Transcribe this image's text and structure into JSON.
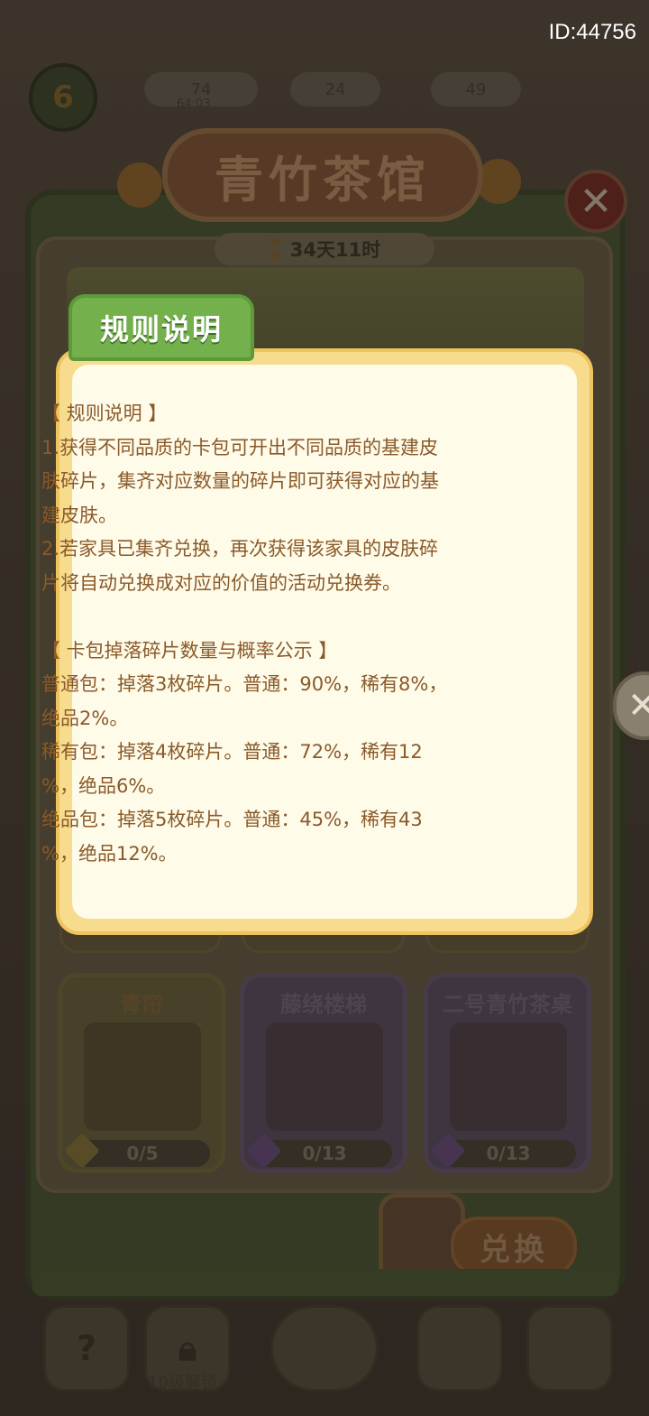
{
  "id_label": "ID:44756",
  "hud": {
    "level": "6",
    "stat1": "74",
    "stat1_sub": "64:03",
    "stat2": "24",
    "stat3": "49"
  },
  "shop": {
    "title": "青竹茶馆",
    "timer": "34天11时",
    "close_icon": "close-icon"
  },
  "rules": {
    "tab_label": "规则说明",
    "lines": [
      "【 规则说明 】",
      "1.获得不同品质的卡包可开出不同品质的基建皮",
      "肤碎片，集齐对应数量的碎片即可获得对应的基",
      "建皮肤。",
      "2.若家具已集齐兑换，再次获得该家具的皮肤碎",
      "片将自动兑换成对应的价值的活动兑换券。",
      "",
      "【 卡包掉落碎片数量与概率公示 】",
      "普通包：掉落3枚碎片。普通：90%，稀有8%，",
      "绝品2%。",
      "稀有包：掉落4枚碎片。普通：72%，稀有12",
      "%，绝品6%。",
      "绝品包：掉落5枚碎片。普通：45%，稀有43",
      "%，绝品12%。"
    ]
  },
  "items": [
    {
      "name": "青帘",
      "progress": "0/5",
      "rarity": "gold"
    },
    {
      "name": "藤绕楼梯",
      "progress": "0/13",
      "rarity": "purple"
    },
    {
      "name": "二号青竹茶桌",
      "progress": "0/13",
      "rarity": "purple"
    }
  ],
  "exchange_label": "兑换",
  "unlock_label": "10级解锁",
  "colors": {
    "rule_tab": "#74b04c",
    "rule_popup_border": "#f7dc8e",
    "rule_text": "#8a5a2a"
  }
}
